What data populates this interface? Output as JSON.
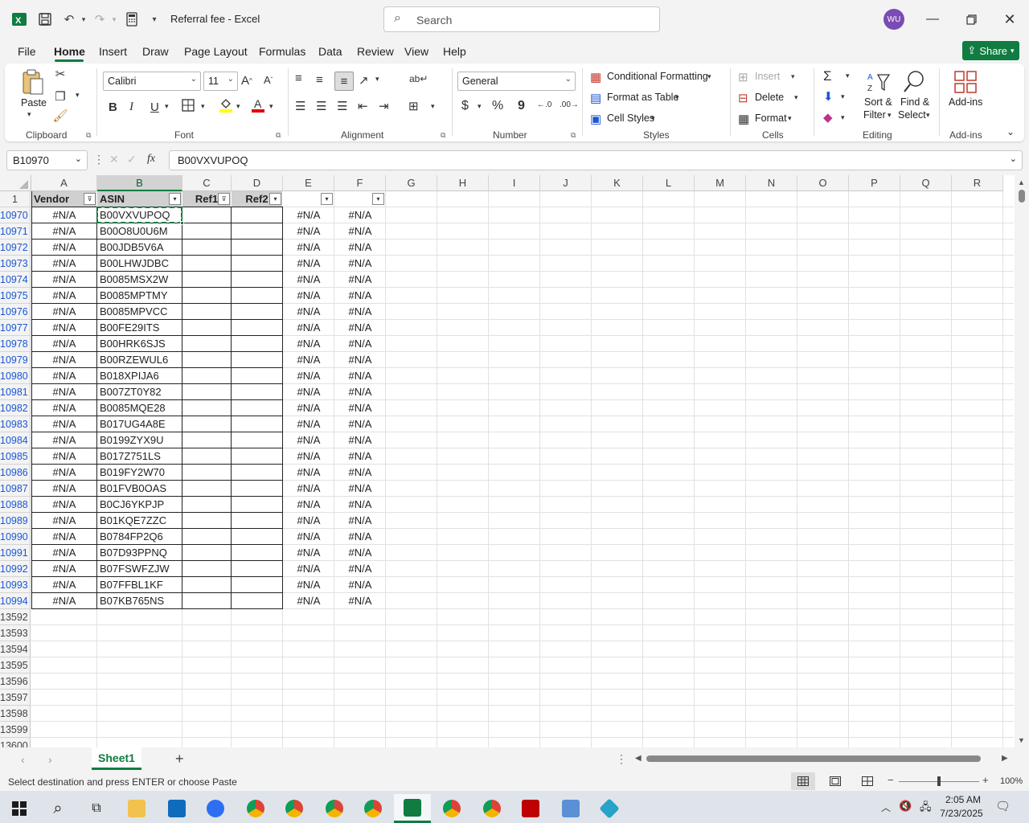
{
  "window": {
    "title": "Referral fee  -  Excel",
    "search_placeholder": "Search",
    "user_initials": "WU"
  },
  "menu": {
    "tabs": [
      "File",
      "Home",
      "Insert",
      "Draw",
      "Page Layout",
      "Formulas",
      "Data",
      "Review",
      "View",
      "Help"
    ],
    "active": "Home",
    "share_label": "Share"
  },
  "ribbon": {
    "clipboard": {
      "paste": "Paste",
      "label": "Clipboard"
    },
    "font": {
      "name": "Calibri",
      "size": "11",
      "label": "Font"
    },
    "alignment": {
      "label": "Alignment"
    },
    "number": {
      "format": "General",
      "currency": "$",
      "percent": "%",
      "comma": "9",
      "label": "Number"
    },
    "styles": {
      "conditional": "Conditional Formatting",
      "format_table": "Format as Table",
      "cell_styles": "Cell Styles",
      "label": "Styles"
    },
    "cells": {
      "insert": "Insert",
      "delete": "Delete",
      "format": "Format",
      "label": "Cells"
    },
    "editing": {
      "sort1": "Sort &",
      "sort2": "Filter",
      "find1": "Find &",
      "find2": "Select",
      "label": "Editing"
    },
    "addins": {
      "btn": "Add-ins",
      "label": "Add-ins"
    }
  },
  "formula_bar": {
    "name_box": "B10970",
    "formula": "B00VXVUPOQ",
    "fx": "fx"
  },
  "sheet": {
    "columns": [
      "A",
      "B",
      "C",
      "D",
      "E",
      "F",
      "G",
      "H",
      "I",
      "J",
      "K",
      "L",
      "M",
      "N",
      "O",
      "P",
      "Q",
      "R"
    ],
    "header_row_num": "1",
    "headers": {
      "A": "Vendor",
      "B": "ASIN",
      "C": "Ref1",
      "D": "Ref2"
    },
    "rows": [
      {
        "num": "10970",
        "a": "#N/A",
        "b": "B00VXVUPOQ",
        "e": "#N/A",
        "f": "#N/A"
      },
      {
        "num": "10971",
        "a": "#N/A",
        "b": "B00O8U0U6M",
        "e": "#N/A",
        "f": "#N/A"
      },
      {
        "num": "10972",
        "a": "#N/A",
        "b": "B00JDB5V6A",
        "e": "#N/A",
        "f": "#N/A"
      },
      {
        "num": "10973",
        "a": "#N/A",
        "b": "B00LHWJDBC",
        "e": "#N/A",
        "f": "#N/A"
      },
      {
        "num": "10974",
        "a": "#N/A",
        "b": "B0085MSX2W",
        "e": "#N/A",
        "f": "#N/A"
      },
      {
        "num": "10975",
        "a": "#N/A",
        "b": "B0085MPTMY",
        "e": "#N/A",
        "f": "#N/A"
      },
      {
        "num": "10976",
        "a": "#N/A",
        "b": "B0085MPVCC",
        "e": "#N/A",
        "f": "#N/A"
      },
      {
        "num": "10977",
        "a": "#N/A",
        "b": "B00FE29ITS",
        "e": "#N/A",
        "f": "#N/A"
      },
      {
        "num": "10978",
        "a": "#N/A",
        "b": "B00HRK6SJS",
        "e": "#N/A",
        "f": "#N/A"
      },
      {
        "num": "10979",
        "a": "#N/A",
        "b": "B00RZEWUL6",
        "e": "#N/A",
        "f": "#N/A"
      },
      {
        "num": "10980",
        "a": "#N/A",
        "b": "B018XPIJA6",
        "e": "#N/A",
        "f": "#N/A"
      },
      {
        "num": "10981",
        "a": "#N/A",
        "b": "B007ZT0Y82",
        "e": "#N/A",
        "f": "#N/A"
      },
      {
        "num": "10982",
        "a": "#N/A",
        "b": "B0085MQE28",
        "e": "#N/A",
        "f": "#N/A"
      },
      {
        "num": "10983",
        "a": "#N/A",
        "b": "B017UG4A8E",
        "e": "#N/A",
        "f": "#N/A"
      },
      {
        "num": "10984",
        "a": "#N/A",
        "b": "B0199ZYX9U",
        "e": "#N/A",
        "f": "#N/A"
      },
      {
        "num": "10985",
        "a": "#N/A",
        "b": "B017Z751LS",
        "e": "#N/A",
        "f": "#N/A"
      },
      {
        "num": "10986",
        "a": "#N/A",
        "b": "B019FY2W70",
        "e": "#N/A",
        "f": "#N/A"
      },
      {
        "num": "10987",
        "a": "#N/A",
        "b": "B01FVB0OAS",
        "e": "#N/A",
        "f": "#N/A"
      },
      {
        "num": "10988",
        "a": "#N/A",
        "b": "B0CJ6YKPJP",
        "e": "#N/A",
        "f": "#N/A"
      },
      {
        "num": "10989",
        "a": "#N/A",
        "b": "B01KQE7ZZC",
        "e": "#N/A",
        "f": "#N/A"
      },
      {
        "num": "10990",
        "a": "#N/A",
        "b": "B0784FP2Q6",
        "e": "#N/A",
        "f": "#N/A"
      },
      {
        "num": "10991",
        "a": "#N/A",
        "b": "B07D93PPNQ",
        "e": "#N/A",
        "f": "#N/A"
      },
      {
        "num": "10992",
        "a": "#N/A",
        "b": "B07FSWFZJW",
        "e": "#N/A",
        "f": "#N/A"
      },
      {
        "num": "10993",
        "a": "#N/A",
        "b": "B07FFBL1KF",
        "e": "#N/A",
        "f": "#N/A"
      },
      {
        "num": "10994",
        "a": "#N/A",
        "b": "B07KB765NS",
        "e": "#N/A",
        "f": "#N/A"
      }
    ],
    "empty_rows": [
      "13592",
      "13593",
      "13594",
      "13595",
      "13596",
      "13597",
      "13598",
      "13599",
      "13600"
    ]
  },
  "sheet_tabs": {
    "active": "Sheet1",
    "add": "+"
  },
  "status": {
    "message": "Select destination and press ENTER or choose Paste",
    "zoom": "100%"
  },
  "taskbar": {
    "time": "2:05 AM",
    "date": "7/23/2025",
    "apps": [
      "file-explorer",
      "outlook",
      "zoom",
      "chrome",
      "chrome",
      "chrome",
      "chrome",
      "excel",
      "chrome",
      "chrome",
      "filezilla",
      "calculator",
      "app"
    ]
  },
  "colors": {
    "accent": "#107c41",
    "filtered_row_num": "#1a56d6",
    "header_fill": "#d0d0d0"
  }
}
